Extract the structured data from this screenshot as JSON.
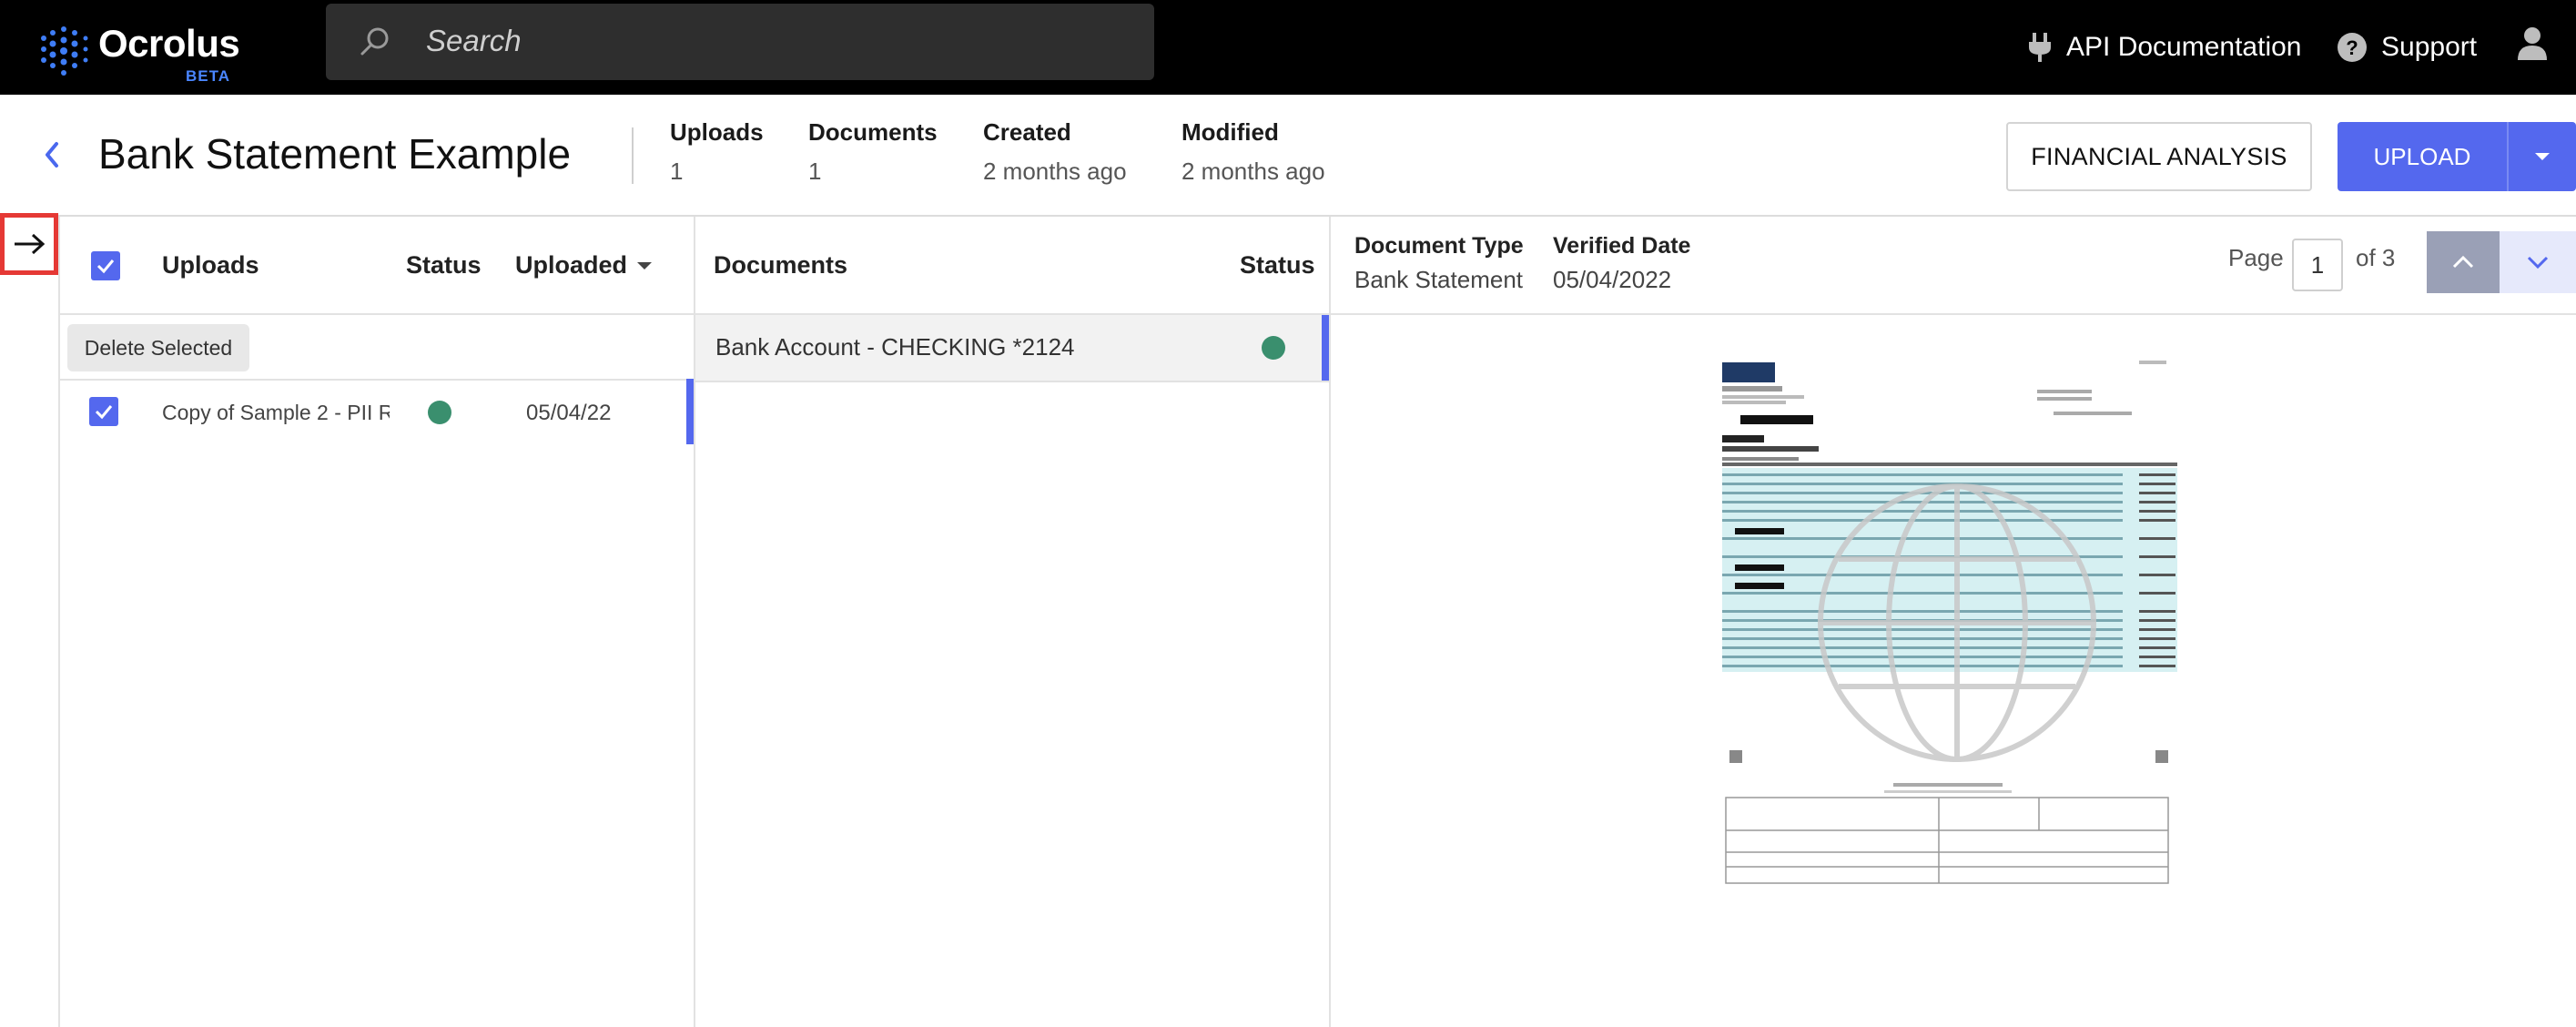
{
  "app": {
    "logo_text": "Ocrolus",
    "logo_badge": "BETA",
    "search_placeholder": "Search",
    "api_link": "API Documentation",
    "support_link": "Support"
  },
  "header": {
    "title": "Bank Statement Example",
    "stats": [
      {
        "label": "Uploads",
        "value": "1"
      },
      {
        "label": "Documents",
        "value": "1"
      },
      {
        "label": "Created",
        "value": "2 months ago"
      },
      {
        "label": "Modified",
        "value": "2 months ago"
      }
    ],
    "financial_analysis_label": "FINANCIAL ANALYSIS",
    "upload_label": "UPLOAD"
  },
  "uploads_panel": {
    "col_uploads": "Uploads",
    "col_status": "Status",
    "col_uploaded": "Uploaded",
    "delete_selected": "Delete Selected",
    "rows": [
      {
        "name": "Copy of Sample 2 - PII R",
        "status_color": "#3a8f6e",
        "date": "05/04/22"
      }
    ]
  },
  "documents_panel": {
    "col_documents": "Documents",
    "col_status": "Status",
    "rows": [
      {
        "name": "Bank Account - CHECKING *2124",
        "status_color": "#3a8f6e"
      }
    ]
  },
  "preview_panel": {
    "doc_type_label": "Document Type",
    "doc_type_value": "Bank Statement",
    "verified_label": "Verified Date",
    "verified_value": "05/04/2022",
    "page_label": "Page",
    "page_current": "1",
    "page_of": "of 3"
  },
  "colors": {
    "accent": "#5468ee",
    "status_ok": "#3a8f6e",
    "highlight_border": "#e53935"
  }
}
